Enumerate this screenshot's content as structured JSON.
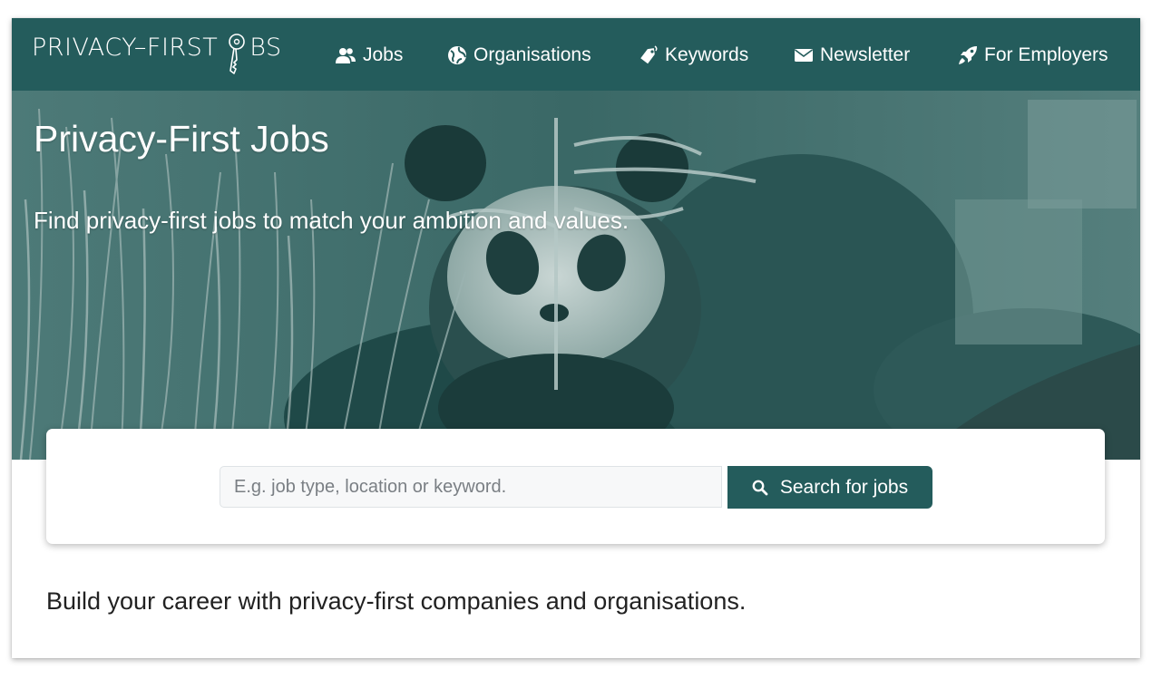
{
  "brand": {
    "logo_text_left": "PRIVACY–FIRST ",
    "logo_text_right": "BS",
    "logo_icon": "key-icon"
  },
  "nav": {
    "items": [
      {
        "label": "Jobs",
        "icon": "users-icon"
      },
      {
        "label": "Organisations",
        "icon": "globe-icon"
      },
      {
        "label": "Keywords",
        "icon": "tag-icon"
      },
      {
        "label": "Newsletter",
        "icon": "envelope-icon"
      },
      {
        "label": "For Employers",
        "icon": "rocket-icon"
      }
    ]
  },
  "hero": {
    "title": "Privacy-First Jobs",
    "subtitle": "Find privacy-first jobs to match your ambition and values.",
    "image": "panda eating bamboo (teal duotone)"
  },
  "search": {
    "placeholder": "E.g. job type, location or keyword.",
    "value": "",
    "button_label": "Search for jobs",
    "button_icon": "search-icon"
  },
  "tagline": "Build your career with privacy-first companies and organisations.",
  "colors": {
    "primary": "#245c5c",
    "hero_tint": "#3b6b69",
    "text_dark": "#222222"
  }
}
